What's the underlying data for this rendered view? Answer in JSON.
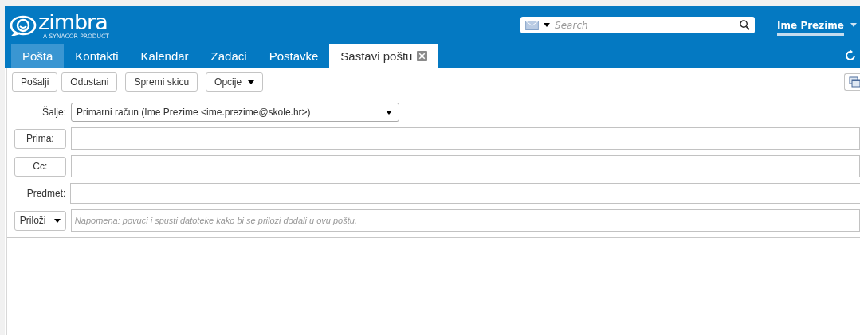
{
  "logo": {
    "wordmark": "zimbra",
    "tagline": "A SYNACOR PRODUCT"
  },
  "search": {
    "placeholder": "Search"
  },
  "user": {
    "name": "Ime Prezime"
  },
  "tabs": [
    {
      "label": "Pošta",
      "selected": false,
      "highlighted": true,
      "closable": false
    },
    {
      "label": "Kontakti",
      "selected": false,
      "highlighted": false,
      "closable": false
    },
    {
      "label": "Kalendar",
      "selected": false,
      "highlighted": false,
      "closable": false
    },
    {
      "label": "Zadaci",
      "selected": false,
      "highlighted": false,
      "closable": false
    },
    {
      "label": "Postavke",
      "selected": false,
      "highlighted": false,
      "closable": false
    },
    {
      "label": "Sastavi poštu",
      "selected": true,
      "highlighted": false,
      "closable": true
    }
  ],
  "toolbar": [
    {
      "label": "Pošalji",
      "kind": "plain"
    },
    {
      "label": "Odustani",
      "kind": "plain"
    },
    {
      "label": "Spremi skicu",
      "kind": "plain"
    },
    {
      "label": "Opcije",
      "kind": "menu"
    }
  ],
  "form": {
    "from": {
      "label": "Šalje:",
      "value": "Primarni račun (Ime Prezime <ime.prezime@skole.hr>)"
    },
    "fields": [
      {
        "kind": "button",
        "label": "Prima:"
      },
      {
        "kind": "button",
        "label": "Cc:"
      },
      {
        "kind": "label",
        "label": "Predmet:"
      },
      {
        "kind": "menu",
        "label": "Priloži",
        "placeholder": "Napomena: povuci i spusti datoteke kako bi se prilozi dodali u ovu poštu."
      }
    ]
  }
}
